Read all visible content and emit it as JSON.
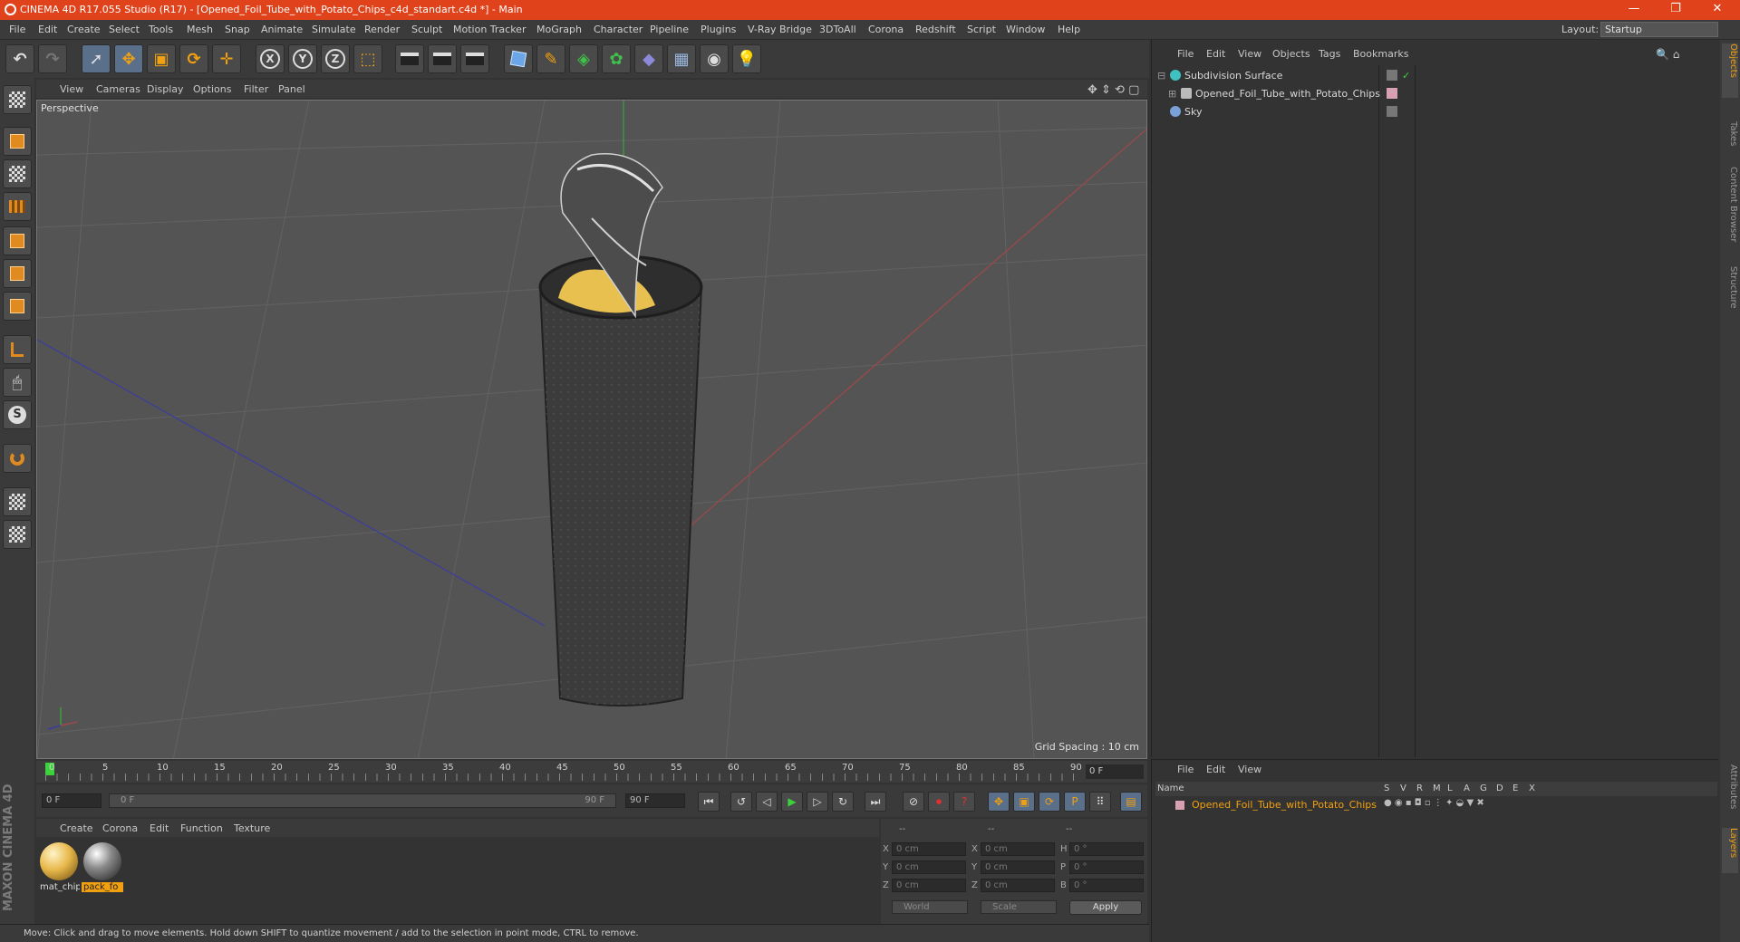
{
  "window": {
    "title": "CINEMA 4D R17.055 Studio (R17) - [Opened_Foil_Tube_with_Potato_Chips_c4d_standart.c4d *] - Main",
    "minimize": "—",
    "restore": "❐",
    "close": "✕"
  },
  "menubar": {
    "items": [
      "File",
      "Edit",
      "Create",
      "Select",
      "Tools",
      "Mesh",
      "Snap",
      "Animate",
      "Simulate",
      "Render",
      "Sculpt",
      "Motion Tracker",
      "MoGraph",
      "Character",
      "Pipeline",
      "Plugins",
      "V-Ray Bridge",
      "3DToAll",
      "Corona",
      "Redshift",
      "Script",
      "Window",
      "Help"
    ],
    "layout_label": "Layout:",
    "layout_value": "Startup"
  },
  "toolbar": {
    "axis_x": "X",
    "axis_y": "Y",
    "axis_z": "Z"
  },
  "viewport": {
    "menu": [
      "View",
      "Cameras",
      "Display",
      "Options",
      "Filter",
      "Panel"
    ],
    "label": "Perspective",
    "grid_spacing": "Grid Spacing : 10 cm"
  },
  "timeline": {
    "ticks": [
      "0",
      "5",
      "10",
      "15",
      "20",
      "25",
      "30",
      "35",
      "40",
      "45",
      "50",
      "55",
      "60",
      "65",
      "70",
      "75",
      "80",
      "85",
      "90"
    ],
    "current_frame": "0 F"
  },
  "playbar": {
    "start_field": "0 F",
    "range_start": "0 F",
    "range_end": "90 F",
    "end_field": "90 F"
  },
  "materials": {
    "menu": [
      "Create",
      "Corona",
      "Edit",
      "Function",
      "Texture"
    ],
    "items": [
      {
        "label": "mat_chip",
        "color": "#e8b84a"
      },
      {
        "label": "pack_fo",
        "color": "#8a8a8a"
      }
    ]
  },
  "coordinates": {
    "col_headers": [
      "--",
      "--",
      "--"
    ],
    "rows": [
      {
        "a": "X",
        "av": "0 cm",
        "b": "X",
        "bv": "0 cm",
        "c": "H",
        "cv": "0 °"
      },
      {
        "a": "Y",
        "av": "0 cm",
        "b": "Y",
        "bv": "0 cm",
        "c": "P",
        "cv": "0 °"
      },
      {
        "a": "Z",
        "av": "0 cm",
        "b": "Z",
        "bv": "0 cm",
        "c": "B",
        "cv": "0 °"
      }
    ],
    "space": "World",
    "mode": "Scale",
    "apply": "Apply"
  },
  "status": {
    "text": "Move: Click and drag to move elements. Hold down SHIFT to quantize movement / add to the selection in point mode, CTRL to remove."
  },
  "object_manager": {
    "menu": [
      "File",
      "Edit",
      "View",
      "Objects",
      "Tags",
      "Bookmarks"
    ],
    "objects": [
      {
        "name": "Subdivision Surface",
        "icon_color": "#3fc1c1"
      },
      {
        "name": "Opened_Foil_Tube_with_Potato_Chips",
        "icon_color": "#bbbbbb"
      },
      {
        "name": "Sky",
        "icon_color": "#7aa0d8"
      }
    ]
  },
  "layer_manager": {
    "menu": [
      "File",
      "Edit",
      "View"
    ],
    "headers": [
      "Name",
      "S",
      "V",
      "R",
      "M",
      "L",
      "A",
      "G",
      "D",
      "E",
      "X"
    ],
    "layer_name": "Opened_Foil_Tube_with_Potato_Chips"
  },
  "right_tabs": [
    "Objects",
    "Takes",
    "Content Browser",
    "Structure",
    "Attributes",
    "Layers"
  ],
  "logo": "MAXON CINEMA 4D",
  "colors": {
    "accent": "#f0a010",
    "titlebar": "#e0431b"
  }
}
